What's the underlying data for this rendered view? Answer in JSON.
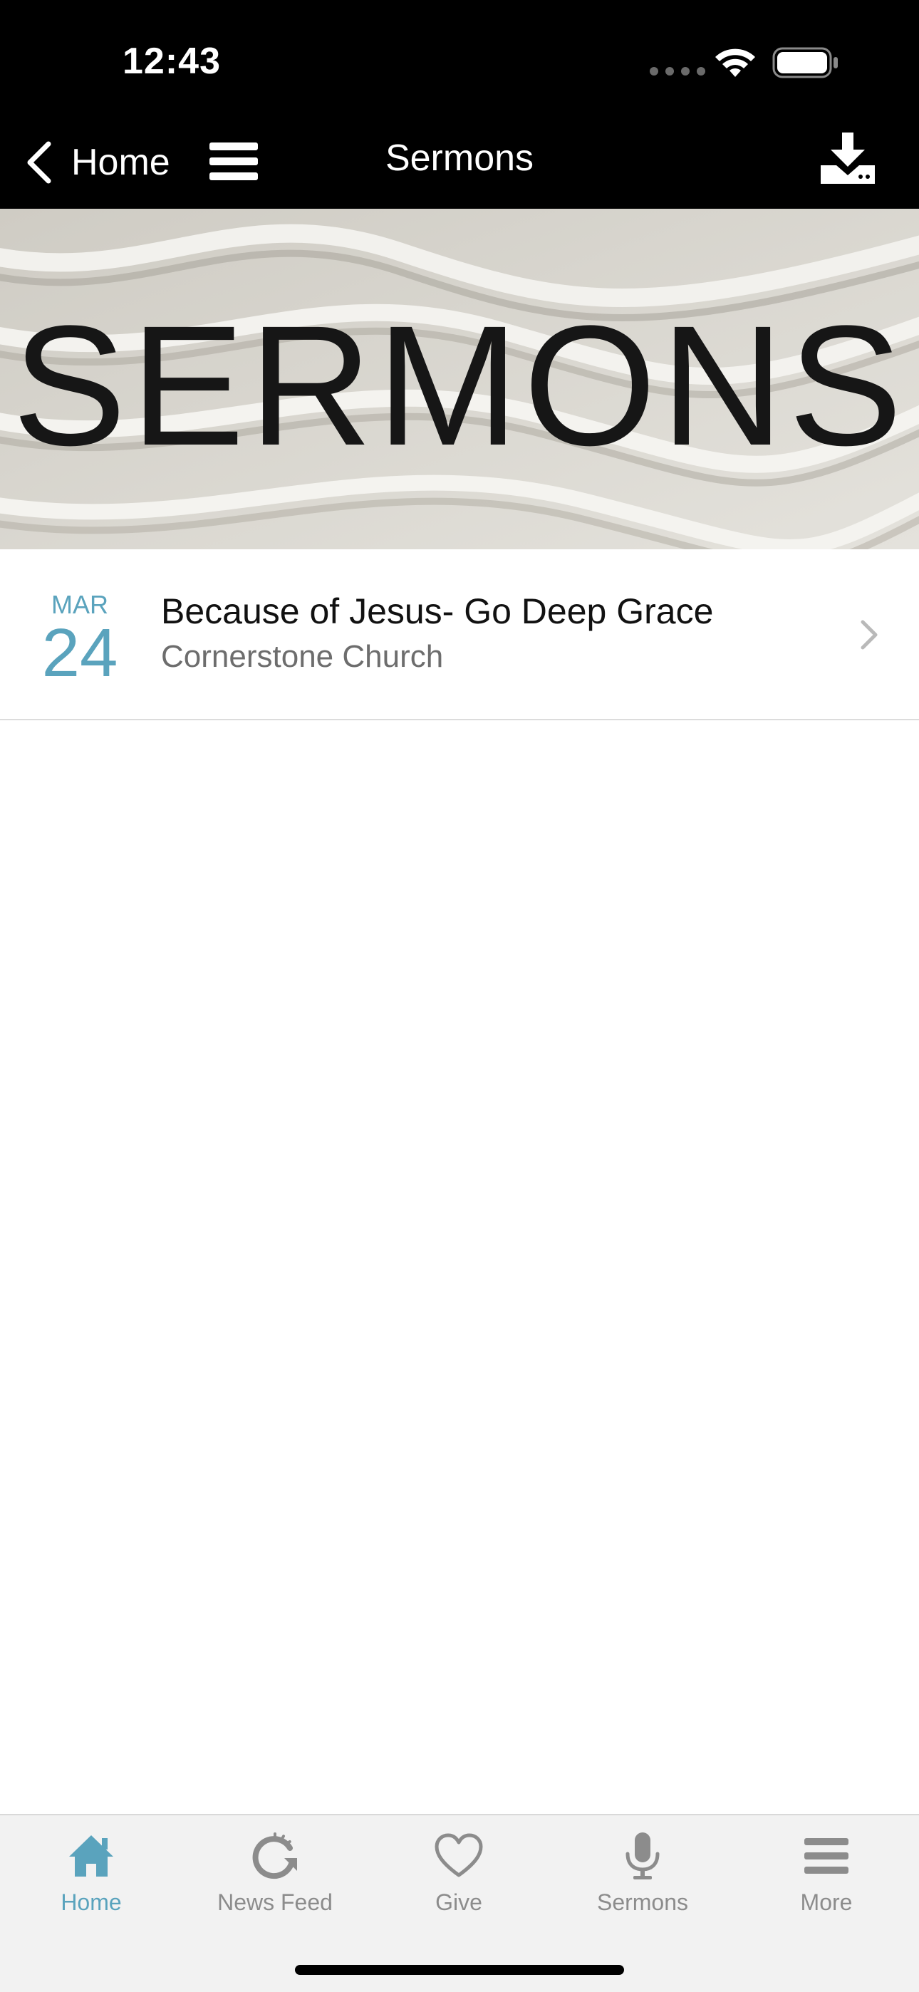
{
  "status": {
    "time": "12:43"
  },
  "nav": {
    "back_label": "Home",
    "title": "Sermons"
  },
  "banner": {
    "text": "SERMONS"
  },
  "sermons": [
    {
      "month": "MAR",
      "day": "24",
      "title": "Because of Jesus- Go Deep Grace",
      "subtitle": "Cornerstone Church"
    }
  ],
  "tabs": [
    {
      "label": "Home",
      "icon": "home-icon",
      "active": true
    },
    {
      "label": "News Feed",
      "icon": "refresh-icon",
      "active": false
    },
    {
      "label": "Give",
      "icon": "heart-icon",
      "active": false
    },
    {
      "label": "Sermons",
      "icon": "microphone-icon",
      "active": false
    },
    {
      "label": "More",
      "icon": "menu-icon",
      "active": false
    }
  ],
  "colors": {
    "accent": "#5aa3bd",
    "tab_inactive": "#8c8c8c",
    "nav_bg": "#000000"
  }
}
